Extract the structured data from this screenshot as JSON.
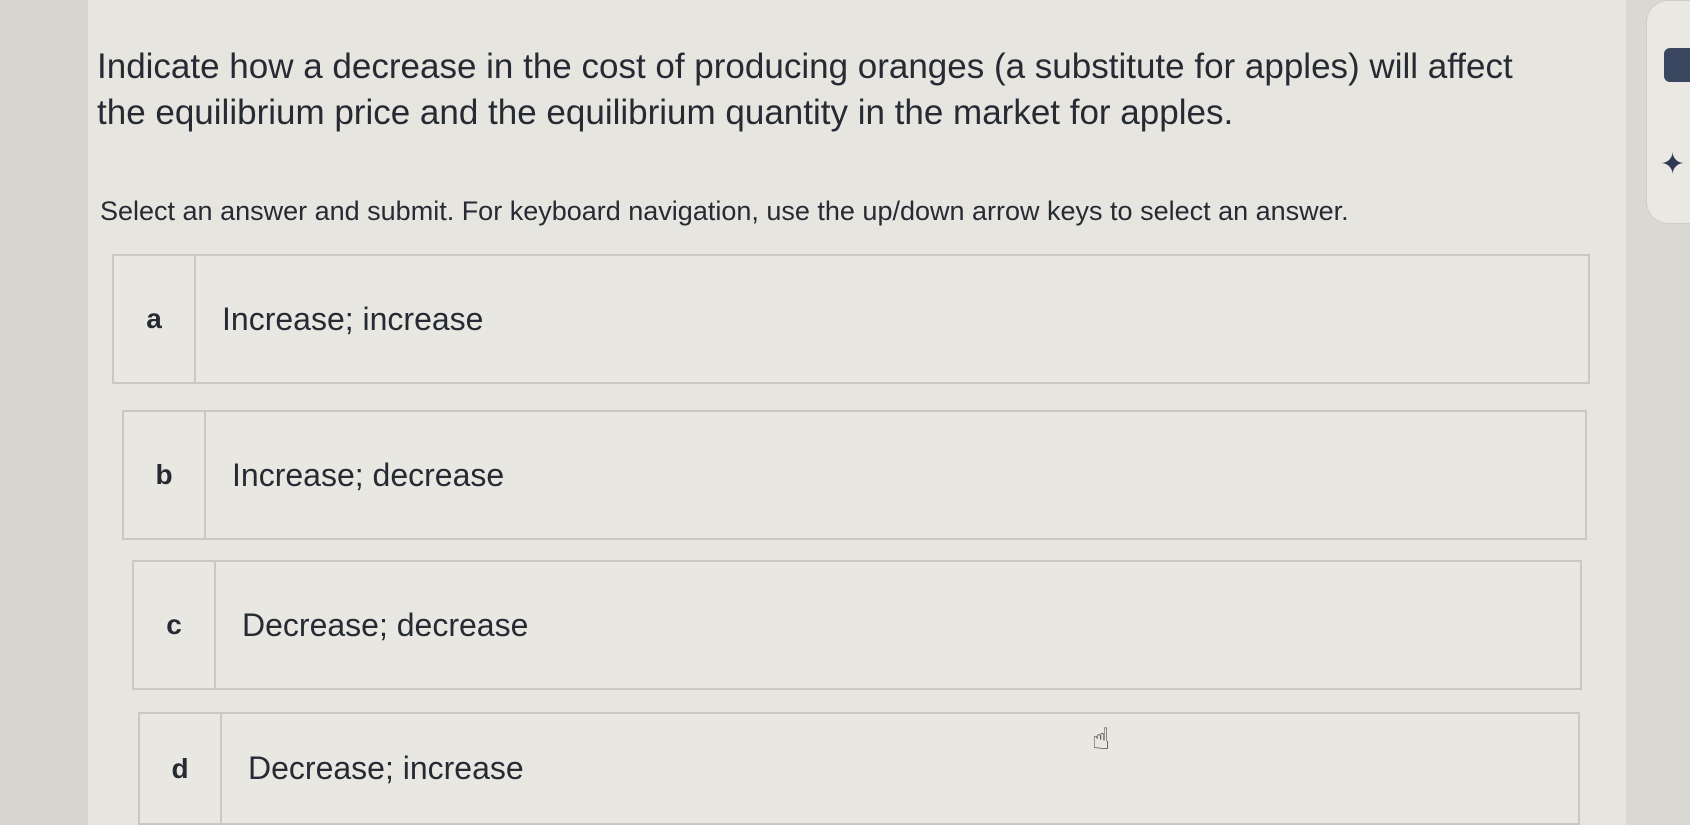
{
  "question": {
    "text": "Indicate how a decrease in the cost of producing oranges (a substitute for apples) will affect the equilibrium price and the equilibrium quantity in the market for apples."
  },
  "instructions": "Select an answer and submit. For keyboard navigation, use the up/down arrow keys to select an answer.",
  "options": [
    {
      "letter": "a",
      "label": "Increase; increase"
    },
    {
      "letter": "b",
      "label": "Increase; decrease"
    },
    {
      "letter": "c",
      "label": "Decrease; decrease"
    },
    {
      "letter": "d",
      "label": "Decrease; increase"
    }
  ],
  "icons": {
    "sidebar_tab": "tab-icon",
    "assistant": "sparkle-icon",
    "cursor": "hand-pointer-icon"
  },
  "colors": {
    "text": "#262a33",
    "panel": "#e6e5e0",
    "border": "#c9c8c2",
    "accent": "#3a4560"
  }
}
